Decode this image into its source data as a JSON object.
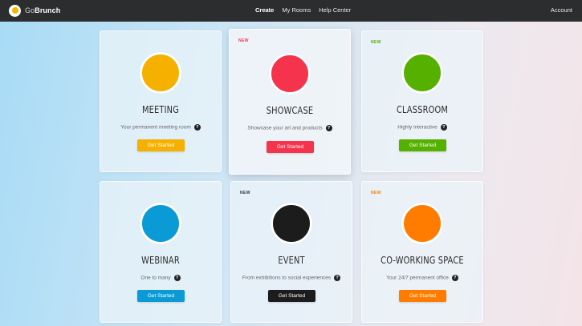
{
  "app": {
    "logo_prefix": "Go",
    "logo_name": "Brunch"
  },
  "nav": {
    "items": [
      "Create",
      "My Rooms",
      "Help Center"
    ],
    "active": "Create",
    "account": "Account"
  },
  "cards": [
    {
      "title": "MEETING",
      "description": "Your permanent meeting room",
      "button": "Get Started",
      "color": "#f6b000",
      "new": "",
      "new_color": ""
    },
    {
      "title": "SHOWCASE",
      "description": "Showcase your art and products",
      "button": "Get Started",
      "color": "#f5334d",
      "new": "NEW",
      "new_color": "#f5334d"
    },
    {
      "title": "CLASSROOM",
      "description": "Highly interactive",
      "button": "Get Started",
      "color": "#55b000",
      "new": "NEW",
      "new_color": "#55b000"
    },
    {
      "title": "WEBINAR",
      "description": "One to many",
      "button": "Get Started",
      "color": "#0a9ad6",
      "new": "",
      "new_color": ""
    },
    {
      "title": "EVENT",
      "description": "From exhibitions to social experiences",
      "button": "Get Started",
      "color": "#1c1c1c",
      "new": "NEW",
      "new_color": "#333333"
    },
    {
      "title": "CO-WORKING SPACE",
      "description": "Your 24/7 permanent office",
      "button": "Get Started",
      "color": "#ff7c00",
      "new": "NEW",
      "new_color": "#ff7c00"
    }
  ],
  "icons": {
    "logo": "gobrunch-egg-logo",
    "help": "question-mark-icon"
  }
}
